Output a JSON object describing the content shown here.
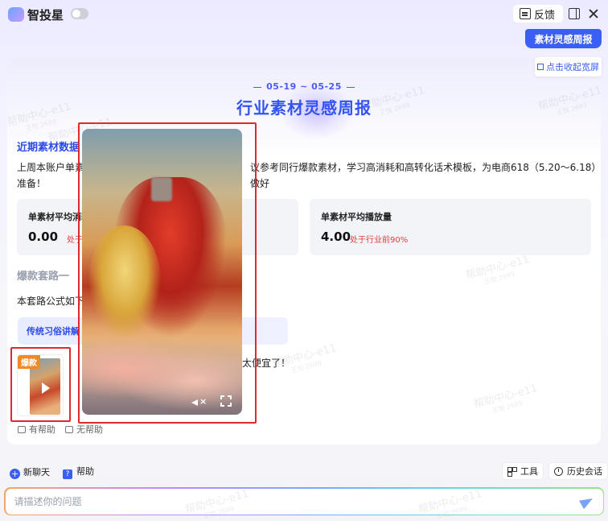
{
  "app": {
    "title": "智投星"
  },
  "topbar": {
    "feedback_label": "反馈"
  },
  "actions": {
    "inspiration_button": "素材灵感周报",
    "collapse_button": "点击收起宽屏"
  },
  "report": {
    "date_range": "05-19 ~ 05-25",
    "title": "行业素材灵感周报",
    "section_recent": "近期素材数据",
    "intro_text": "上周本账户单素材",
    "intro_text_cont": "议参考同行爆款素材，学习高消耗和高转化话术模板，为电商618（5.20～6.18）做好",
    "intro_text_end": "准备！",
    "metrics": [
      {
        "label": "单素材平均消耗",
        "value": "0.00",
        "note": "处于行"
      },
      {
        "label": "单素材平均播放量",
        "value": "4.00",
        "note": "处于行业前90%"
      }
    ],
    "section_hot": "爆款套路一",
    "formula_text": "本套路公式如下：",
    "tag_label": "传统习俗讲解",
    "thumb_badge": "爆款",
    "side_text": "，太便宜了！",
    "helpful_label": "有帮助",
    "unhelpful_label": "无帮助"
  },
  "toolbar": {
    "new_chat_label": "新聊天",
    "help_label": "帮助",
    "tools_label": "工具",
    "history_label": "历史会话"
  },
  "input": {
    "placeholder": "请描述你的问题"
  },
  "watermark": {
    "text": "帮助中心-e11",
    "sub": "王悦 2699"
  }
}
